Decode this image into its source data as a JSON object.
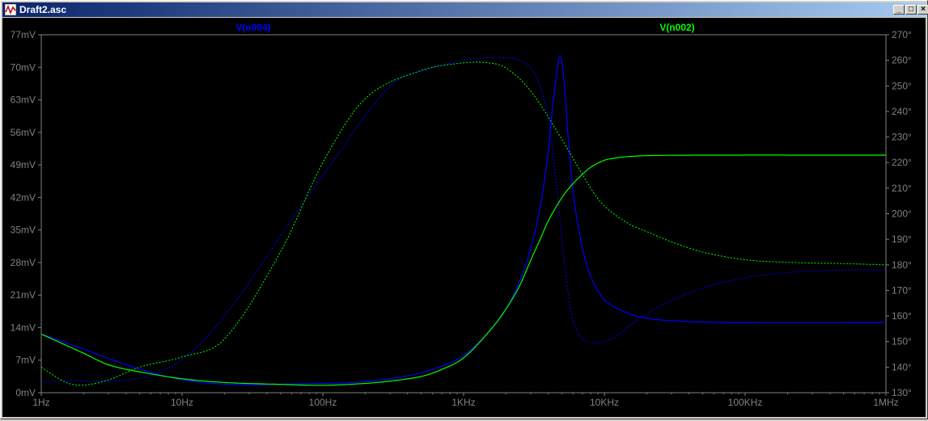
{
  "window": {
    "title": "Draft2.asc",
    "min_glyph": "_",
    "max_glyph": "□",
    "close_glyph": "×"
  },
  "chart_data": {
    "type": "line",
    "x_scale": "log",
    "xlim": [
      1,
      1000000
    ],
    "x_ticks": [
      {
        "value": 1,
        "label": "1Hz"
      },
      {
        "value": 10,
        "label": "10Hz"
      },
      {
        "value": 100,
        "label": "100Hz"
      },
      {
        "value": 1000,
        "label": "1KHz"
      },
      {
        "value": 10000,
        "label": "10KHz"
      },
      {
        "value": 100000,
        "label": "100KHz"
      },
      {
        "value": 1000000,
        "label": "1MHz"
      }
    ],
    "left_axis": {
      "ylim": [
        0,
        77
      ],
      "ticks": [
        0,
        7,
        14,
        21,
        28,
        35,
        42,
        49,
        56,
        63,
        70,
        77
      ],
      "labels": [
        "0mV",
        "7mV",
        "14mV",
        "21mV",
        "28mV",
        "35mV",
        "42mV",
        "49mV",
        "56mV",
        "63mV",
        "70mV",
        "77mV"
      ]
    },
    "right_axis": {
      "ylim": [
        130,
        270
      ],
      "ticks": [
        130,
        140,
        150,
        160,
        170,
        180,
        190,
        200,
        210,
        220,
        230,
        240,
        250,
        260,
        270
      ],
      "labels": [
        "130°",
        "140°",
        "150°",
        "160°",
        "170°",
        "180°",
        "190°",
        "200°",
        "210°",
        "220°",
        "230°",
        "240°",
        "250°",
        "260°",
        "270°"
      ]
    },
    "grid": false,
    "series": [
      {
        "name": "V(n004)",
        "color": "#0000ff",
        "magnitude_mV": {
          "x": [
            1,
            10,
            100,
            300,
            600,
            1000,
            1500,
            2000,
            2500,
            3000,
            3500,
            4000,
            4300,
            4600,
            4800,
            5000,
            5200,
            5500,
            6000,
            7000,
            8000,
            10000,
            15000,
            20000,
            30000,
            50000,
            100000,
            1000000
          ],
          "y": [
            12.6,
            2.8,
            2.0,
            3.0,
            5.0,
            8.0,
            13.0,
            18.0,
            24.0,
            31.0,
            40.0,
            52.0,
            62.0,
            69.0,
            72.3,
            71.0,
            66.0,
            56.0,
            43.0,
            31.0,
            25.0,
            20.0,
            17.0,
            16.0,
            15.5,
            15.2,
            15.1,
            15.1
          ]
        },
        "phase_deg": {
          "x": [
            1,
            10,
            100,
            300,
            600,
            1000,
            1500,
            2000,
            2500,
            3000,
            3500,
            4000,
            4500,
            5000,
            5500,
            6000,
            7000,
            8000,
            9000,
            10000,
            12000,
            15000,
            20000,
            30000,
            50000,
            100000,
            200000,
            500000,
            1000000
          ],
          "y": [
            134,
            143,
            215,
            250,
            257,
            260,
            261,
            261,
            260,
            257,
            250,
            237,
            215,
            190,
            170,
            158,
            151,
            149.5,
            149.5,
            150,
            152,
            156,
            161,
            166,
            171,
            175,
            177,
            178,
            178
          ]
        }
      },
      {
        "name": "V(n002)",
        "color": "#00ff00",
        "magnitude_mV": {
          "x": [
            1,
            2,
            3,
            5,
            10,
            20,
            50,
            100,
            200,
            300,
            500,
            700,
            1000,
            1500,
            2000,
            2500,
            3000,
            3500,
            4000,
            5000,
            6000,
            7000,
            8000,
            10000,
            12000,
            15000,
            20000,
            50000,
            1000000
          ],
          "y": [
            12.6,
            8.5,
            6.0,
            4.5,
            3.0,
            2.2,
            1.8,
            1.6,
            2.0,
            2.5,
            3.5,
            5.0,
            7.5,
            13.0,
            18.0,
            23.0,
            28.5,
            33.0,
            37.0,
            42.0,
            45.0,
            47.0,
            48.5,
            50.0,
            50.5,
            50.8,
            51.0,
            51.1,
            51.1
          ]
        },
        "phase_deg": {
          "x": [
            1,
            1.5,
            2,
            3,
            5,
            10,
            20,
            50,
            100,
            200,
            500,
            1000,
            1500,
            2000,
            3000,
            5000,
            8000,
            10000,
            15000,
            20000,
            30000,
            50000,
            100000,
            200000,
            500000,
            1000000
          ],
          "y": [
            140,
            134,
            133,
            135,
            140,
            144,
            151,
            185,
            220,
            245,
            256,
            259,
            259,
            257,
            248,
            229,
            210,
            203,
            196,
            193,
            189,
            185,
            182,
            181,
            180.5,
            180
          ]
        }
      }
    ]
  }
}
